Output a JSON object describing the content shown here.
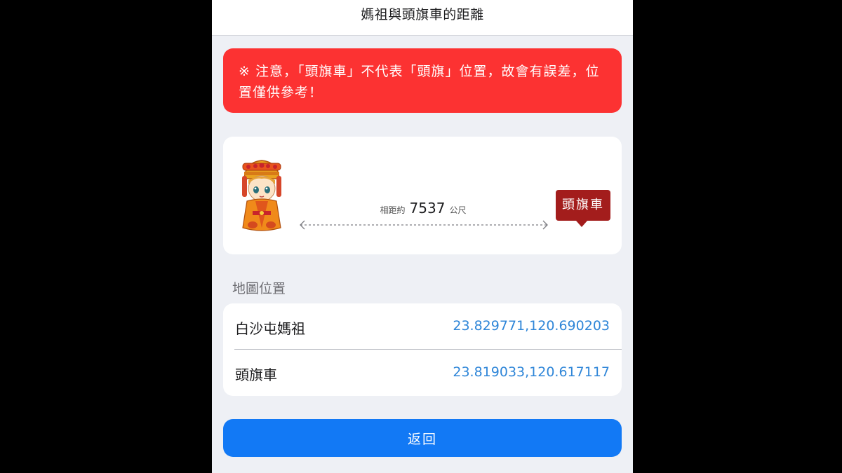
{
  "header": {
    "title": "媽祖與頭旗車的距離"
  },
  "warning": {
    "text": "※ 注意，「頭旗車」不代表「頭旗」位置，故會有誤差，位置僅供參考！"
  },
  "distance": {
    "prefix": "相距約",
    "value": "7537",
    "unit": "公尺",
    "from_icon": "mazu-character-icon",
    "to_label": "頭旗車"
  },
  "map_section": {
    "label": "地圖位置",
    "rows": [
      {
        "name": "白沙屯媽祖",
        "coords": "23.829771,120.690203"
      },
      {
        "name": "頭旗車",
        "coords": "23.819033,120.617117"
      }
    ]
  },
  "actions": {
    "back_label": "返回"
  },
  "colors": {
    "warning_bg": "#fc3232",
    "badge_bg": "#a31d1c",
    "coord_text": "#2f86d8",
    "button_bg": "#1279f5",
    "page_bg": "#eef0f5"
  }
}
